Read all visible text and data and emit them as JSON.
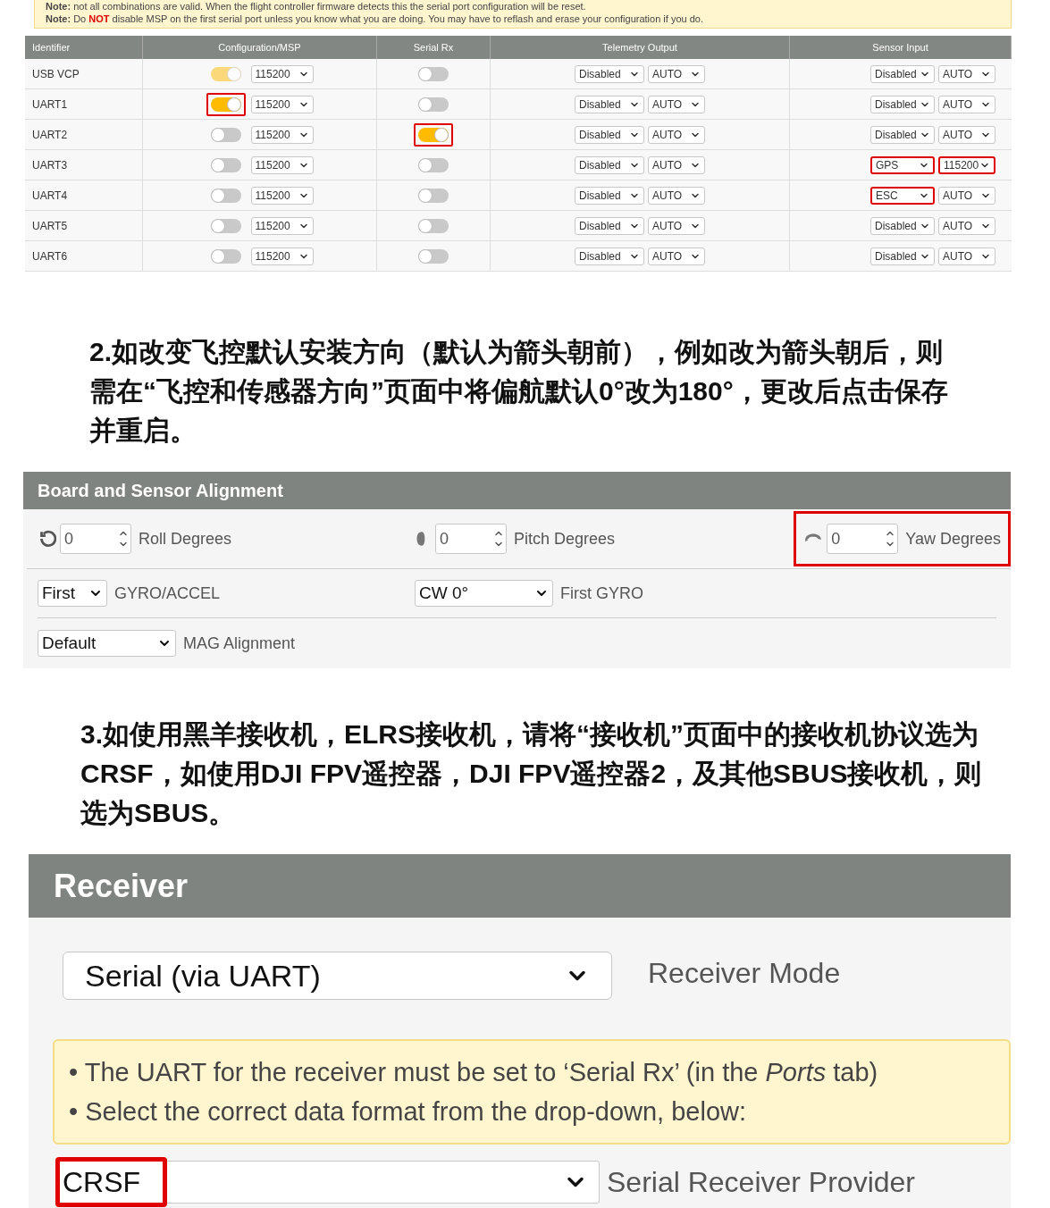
{
  "ports_notes": [
    {
      "label": "Note:",
      "text": "not all combinations are valid. When the flight controller firmware detects this the serial port configuration will be reset."
    },
    {
      "label": "Note:",
      "text": "Do **NOT** disable MSP on the first serial port unless you know what you are doing. You may have to reflash and erase your configuration if you do."
    }
  ],
  "ports_table": {
    "columns": [
      "Identifier",
      "Configuration/MSP",
      "Serial Rx",
      "Telemetry Output",
      "Sensor Input"
    ],
    "rows": [
      {
        "identifier": "USB VCP",
        "msp": {
          "on": true,
          "disabled": true,
          "highlighted": false
        },
        "msp_baud": "115200",
        "serial_rx": {
          "on": false,
          "highlighted": false
        },
        "telemetry": "Disabled",
        "telemetry_baud": "AUTO",
        "sensor": {
          "value": "Disabled",
          "highlighted": false
        },
        "sensor_baud": {
          "value": "AUTO",
          "highlighted": false
        }
      },
      {
        "identifier": "UART1",
        "msp": {
          "on": true,
          "disabled": false,
          "highlighted": true
        },
        "msp_baud": "115200",
        "serial_rx": {
          "on": false,
          "highlighted": false
        },
        "telemetry": "Disabled",
        "telemetry_baud": "AUTO",
        "sensor": {
          "value": "Disabled",
          "highlighted": false
        },
        "sensor_baud": {
          "value": "AUTO",
          "highlighted": false
        }
      },
      {
        "identifier": "UART2",
        "msp": {
          "on": false,
          "disabled": false,
          "highlighted": false
        },
        "msp_baud": "115200",
        "serial_rx": {
          "on": true,
          "highlighted": true
        },
        "telemetry": "Disabled",
        "telemetry_baud": "AUTO",
        "sensor": {
          "value": "Disabled",
          "highlighted": false
        },
        "sensor_baud": {
          "value": "AUTO",
          "highlighted": false
        }
      },
      {
        "identifier": "UART3",
        "msp": {
          "on": false,
          "disabled": false,
          "highlighted": false
        },
        "msp_baud": "115200",
        "serial_rx": {
          "on": false,
          "highlighted": false
        },
        "telemetry": "Disabled",
        "telemetry_baud": "AUTO",
        "sensor": {
          "value": "GPS",
          "highlighted": true
        },
        "sensor_baud": {
          "value": "115200",
          "highlighted": true
        }
      },
      {
        "identifier": "UART4",
        "msp": {
          "on": false,
          "disabled": false,
          "highlighted": false
        },
        "msp_baud": "115200",
        "serial_rx": {
          "on": false,
          "highlighted": false
        },
        "telemetry": "Disabled",
        "telemetry_baud": "AUTO",
        "sensor": {
          "value": "ESC",
          "highlighted": true
        },
        "sensor_baud": {
          "value": "AUTO",
          "highlighted": false
        }
      },
      {
        "identifier": "UART5",
        "msp": {
          "on": false,
          "disabled": false,
          "highlighted": false
        },
        "msp_baud": "115200",
        "serial_rx": {
          "on": false,
          "highlighted": false
        },
        "telemetry": "Disabled",
        "telemetry_baud": "AUTO",
        "sensor": {
          "value": "Disabled",
          "highlighted": false
        },
        "sensor_baud": {
          "value": "AUTO",
          "highlighted": false
        }
      },
      {
        "identifier": "UART6",
        "msp": {
          "on": false,
          "disabled": false,
          "highlighted": false
        },
        "msp_baud": "115200",
        "serial_rx": {
          "on": false,
          "highlighted": false
        },
        "telemetry": "Disabled",
        "telemetry_baud": "AUTO",
        "sensor": {
          "value": "Disabled",
          "highlighted": false
        },
        "sensor_baud": {
          "value": "AUTO",
          "highlighted": false
        }
      }
    ]
  },
  "step_2": "2.如改变飞控默认安装方向（默认为箭头朝前），例如改为箭头朝后，则需在“飞控和传感器方向”页面中将偏航默认0°改为180°，更改后点击保存并重启。",
  "alignment_panel": {
    "title": "Board and Sensor Alignment",
    "degrees": [
      {
        "kind": "roll",
        "angle": "0",
        "caption": "Roll Degrees",
        "highlighted": false
      },
      {
        "kind": "pitch",
        "angle": "0",
        "caption": "Pitch Degrees",
        "highlighted": false
      },
      {
        "kind": "yaw",
        "angle": "0",
        "caption": "Yaw Degrees",
        "highlighted": true
      }
    ],
    "gyro_select": "First",
    "gyro_label": "GYRO/ACCEL",
    "gyro_align_select": "CW 0°",
    "gyro_align_label": "First GYRO",
    "mag_select": "Default",
    "mag_label": "MAG Alignment"
  },
  "step_3": "3.如使用黑羊接收机，ELRS接收机，请将“接收机”页面中的接收机协议选为CRSF，如使用DJI FPV遥控器，DJI FPV遥控器2，及其他SBUS接收机，则选为SBUS。",
  "receiver_panel": {
    "title": "Receiver",
    "mode_select": "Serial (via UART)",
    "mode_label": "Receiver Mode",
    "notes": [
      "• The UART for the receiver must be set to ‘Serial Rx’ (in the *Ports* tab)",
      "• Select the correct data format from the drop-down, below:"
    ],
    "provider_select": {
      "value": "CRSF",
      "highlighted": true
    },
    "provider_label": "Serial Receiver Provider"
  }
}
